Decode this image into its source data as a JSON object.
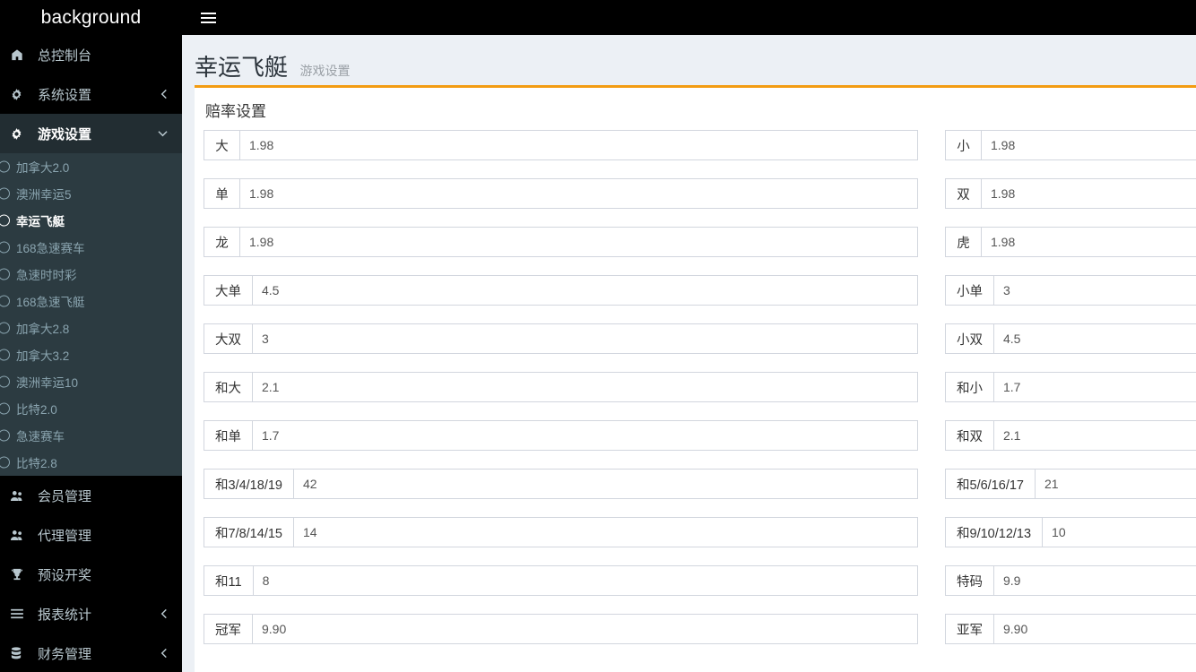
{
  "topbar": {
    "logo": "background",
    "menu_toggle_icon": "hamburger-icon"
  },
  "sidebar": {
    "items": [
      {
        "label": "总控制台",
        "icon": "dashboard-icon",
        "caret": "",
        "active": false
      },
      {
        "label": "系统设置",
        "icon": "gear-icon",
        "caret": "left",
        "active": false
      },
      {
        "label": "游戏设置",
        "icon": "gear-icon",
        "caret": "down",
        "active": true
      },
      {
        "label": "会员管理",
        "icon": "users-icon",
        "caret": "",
        "active": false
      },
      {
        "label": "代理管理",
        "icon": "users-icon",
        "caret": "",
        "active": false
      },
      {
        "label": "预设开奖",
        "icon": "trophy-icon",
        "caret": "",
        "active": false
      },
      {
        "label": "报表统计",
        "icon": "list-icon",
        "caret": "left",
        "active": false
      },
      {
        "label": "财务管理",
        "icon": "database-icon",
        "caret": "left",
        "active": false
      }
    ],
    "submenu": [
      {
        "label": "加拿大2.0",
        "active": false
      },
      {
        "label": "澳洲幸运5",
        "active": false
      },
      {
        "label": "幸运飞艇",
        "active": true
      },
      {
        "label": "168急速赛车",
        "active": false
      },
      {
        "label": "急速时时彩",
        "active": false
      },
      {
        "label": "168急速飞艇",
        "active": false
      },
      {
        "label": "加拿大2.8",
        "active": false
      },
      {
        "label": "加拿大3.2",
        "active": false
      },
      {
        "label": "澳洲幸运10",
        "active": false
      },
      {
        "label": "比特2.0",
        "active": false
      },
      {
        "label": "急速赛车",
        "active": false
      },
      {
        "label": "比特2.8",
        "active": false
      }
    ]
  },
  "page": {
    "title": "幸运飞艇",
    "subtitle": "游戏设置",
    "panel_heading": "赔率设置",
    "accent_color": "#f39c12"
  },
  "form": {
    "rows": [
      {
        "left": {
          "label": "大",
          "value": "1.98"
        },
        "right": {
          "label": "小",
          "value": "1.98"
        }
      },
      {
        "left": {
          "label": "单",
          "value": "1.98"
        },
        "right": {
          "label": "双",
          "value": "1.98"
        }
      },
      {
        "left": {
          "label": "龙",
          "value": "1.98"
        },
        "right": {
          "label": "虎",
          "value": "1.98"
        }
      },
      {
        "left": {
          "label": "大单",
          "value": "4.5"
        },
        "right": {
          "label": "小单",
          "value": "3"
        }
      },
      {
        "left": {
          "label": "大双",
          "value": "3"
        },
        "right": {
          "label": "小双",
          "value": "4.5"
        }
      },
      {
        "left": {
          "label": "和大",
          "value": "2.1"
        },
        "right": {
          "label": "和小",
          "value": "1.7"
        }
      },
      {
        "left": {
          "label": "和单",
          "value": "1.7"
        },
        "right": {
          "label": "和双",
          "value": "2.1"
        }
      },
      {
        "left": {
          "label": "和3/4/18/19",
          "value": "42"
        },
        "right": {
          "label": "和5/6/16/17",
          "value": "21"
        }
      },
      {
        "left": {
          "label": "和7/8/14/15",
          "value": "14"
        },
        "right": {
          "label": "和9/10/12/13",
          "value": "10"
        }
      },
      {
        "left": {
          "label": "和11",
          "value": "8"
        },
        "right": {
          "label": "特码",
          "value": "9.9"
        }
      },
      {
        "left": {
          "label": "冠军",
          "value": "9.90"
        },
        "right": {
          "label": "亚军",
          "value": "9.90"
        }
      }
    ]
  }
}
